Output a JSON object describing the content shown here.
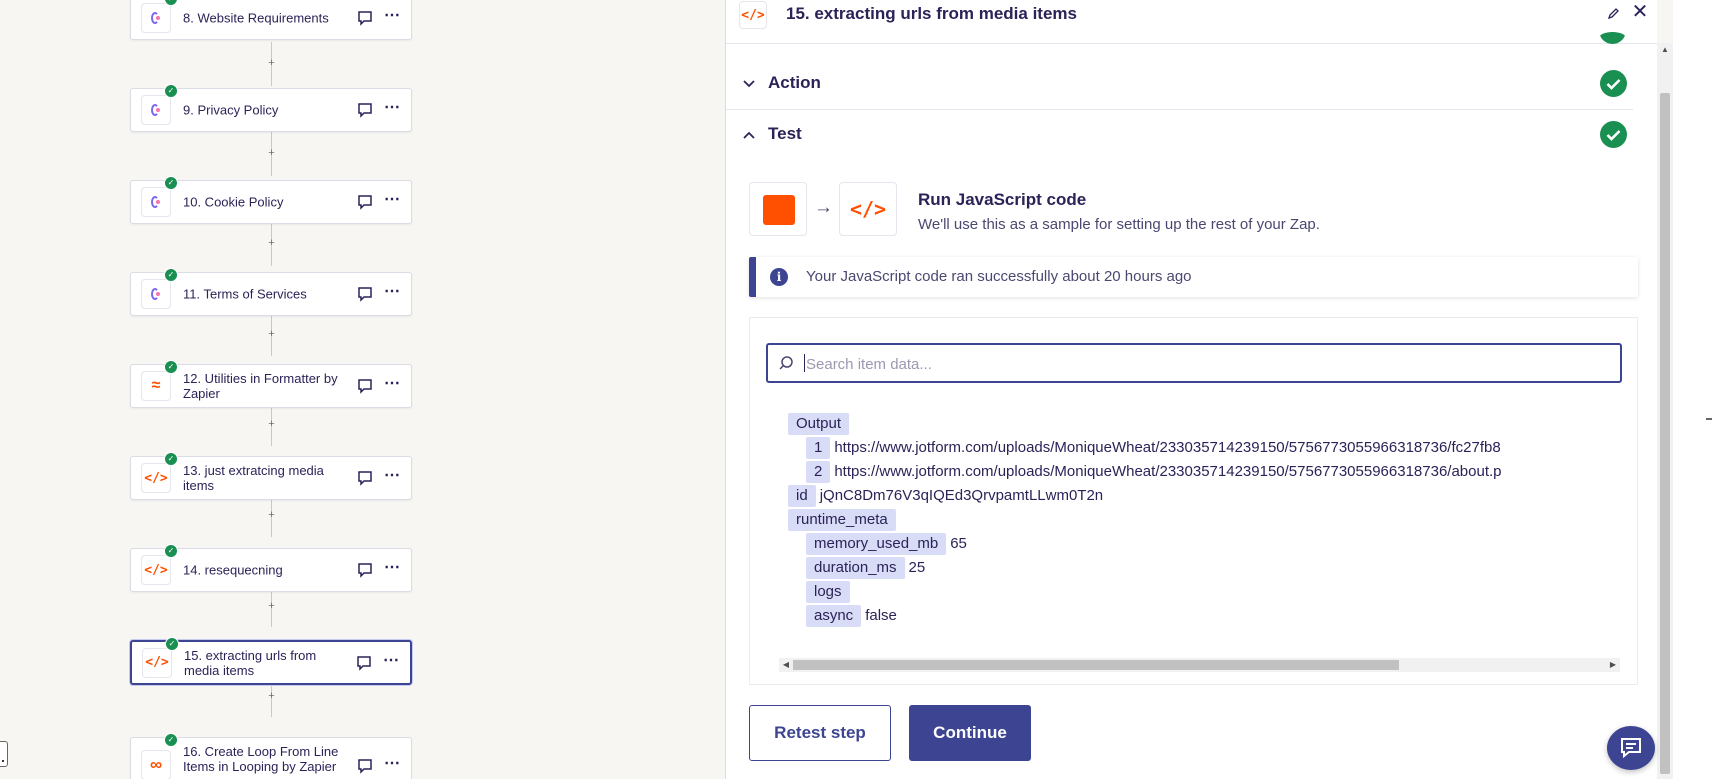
{
  "workflow": {
    "steps": [
      {
        "num_label": "8. Website Requirements",
        "icon": "clickup-icon"
      },
      {
        "num_label": "9. Privacy Policy",
        "icon": "clickup-icon"
      },
      {
        "num_label": "10. Cookie Policy",
        "icon": "clickup-icon"
      },
      {
        "num_label": "11. Terms of Services",
        "icon": "clickup-icon"
      },
      {
        "num_label": "12. Utilities in Formatter by Zapier",
        "icon": "formatter-icon"
      },
      {
        "num_label": "13. just extratcing media items",
        "icon": "code-icon"
      },
      {
        "num_label": "14. resequecning",
        "icon": "code-icon"
      },
      {
        "num_label": "15. extracting urls from media items",
        "icon": "code-icon",
        "selected": true
      },
      {
        "num_label": "16. Create Loop From Line Items in Looping by Zapier",
        "icon": "loop-icon"
      }
    ],
    "connector_glyph": "+",
    "more_glyph": "⋯"
  },
  "panel": {
    "title": "15. extracting urls from media items",
    "close_glyph": "✕",
    "sections": {
      "action_label": "Action",
      "test_label": "Test"
    },
    "test": {
      "run_title": "Run JavaScript code",
      "run_subtitle": "We'll use this as a sample for setting up the rest of your Zap.",
      "arrow_glyph": "→",
      "info_icon_glyph": "i",
      "info_message": "Your JavaScript code ran successfully about 20 hours ago",
      "search_placeholder": "Search item data...",
      "tree": {
        "output_key": "Output",
        "output_items": [
          {
            "key": "1",
            "value": "https://www.jotform.com/uploads/MoniqueWheat/233035714239150/5756773055966318736/fc27fb8"
          },
          {
            "key": "2",
            "value": "https://www.jotform.com/uploads/MoniqueWheat/233035714239150/5756773055966318736/about.p"
          }
        ],
        "id_key": "id",
        "id_value": "jQnC8Dm76V3qIQEd3QrvpamtLLwm0T2n",
        "runtime_key": "runtime_meta",
        "runtime_items": [
          {
            "key": "memory_used_mb",
            "value": "65"
          },
          {
            "key": "duration_ms",
            "value": "25"
          },
          {
            "key": "logs",
            "value": ""
          },
          {
            "key": "async",
            "value": "false"
          }
        ]
      },
      "retest_label": "Retest step",
      "continue_label": "Continue"
    }
  },
  "colors": {
    "brand_orange": "#ff4f00",
    "primary": "#3d4592",
    "success": "#1a8f52",
    "key_bg": "#d8dcf6"
  }
}
